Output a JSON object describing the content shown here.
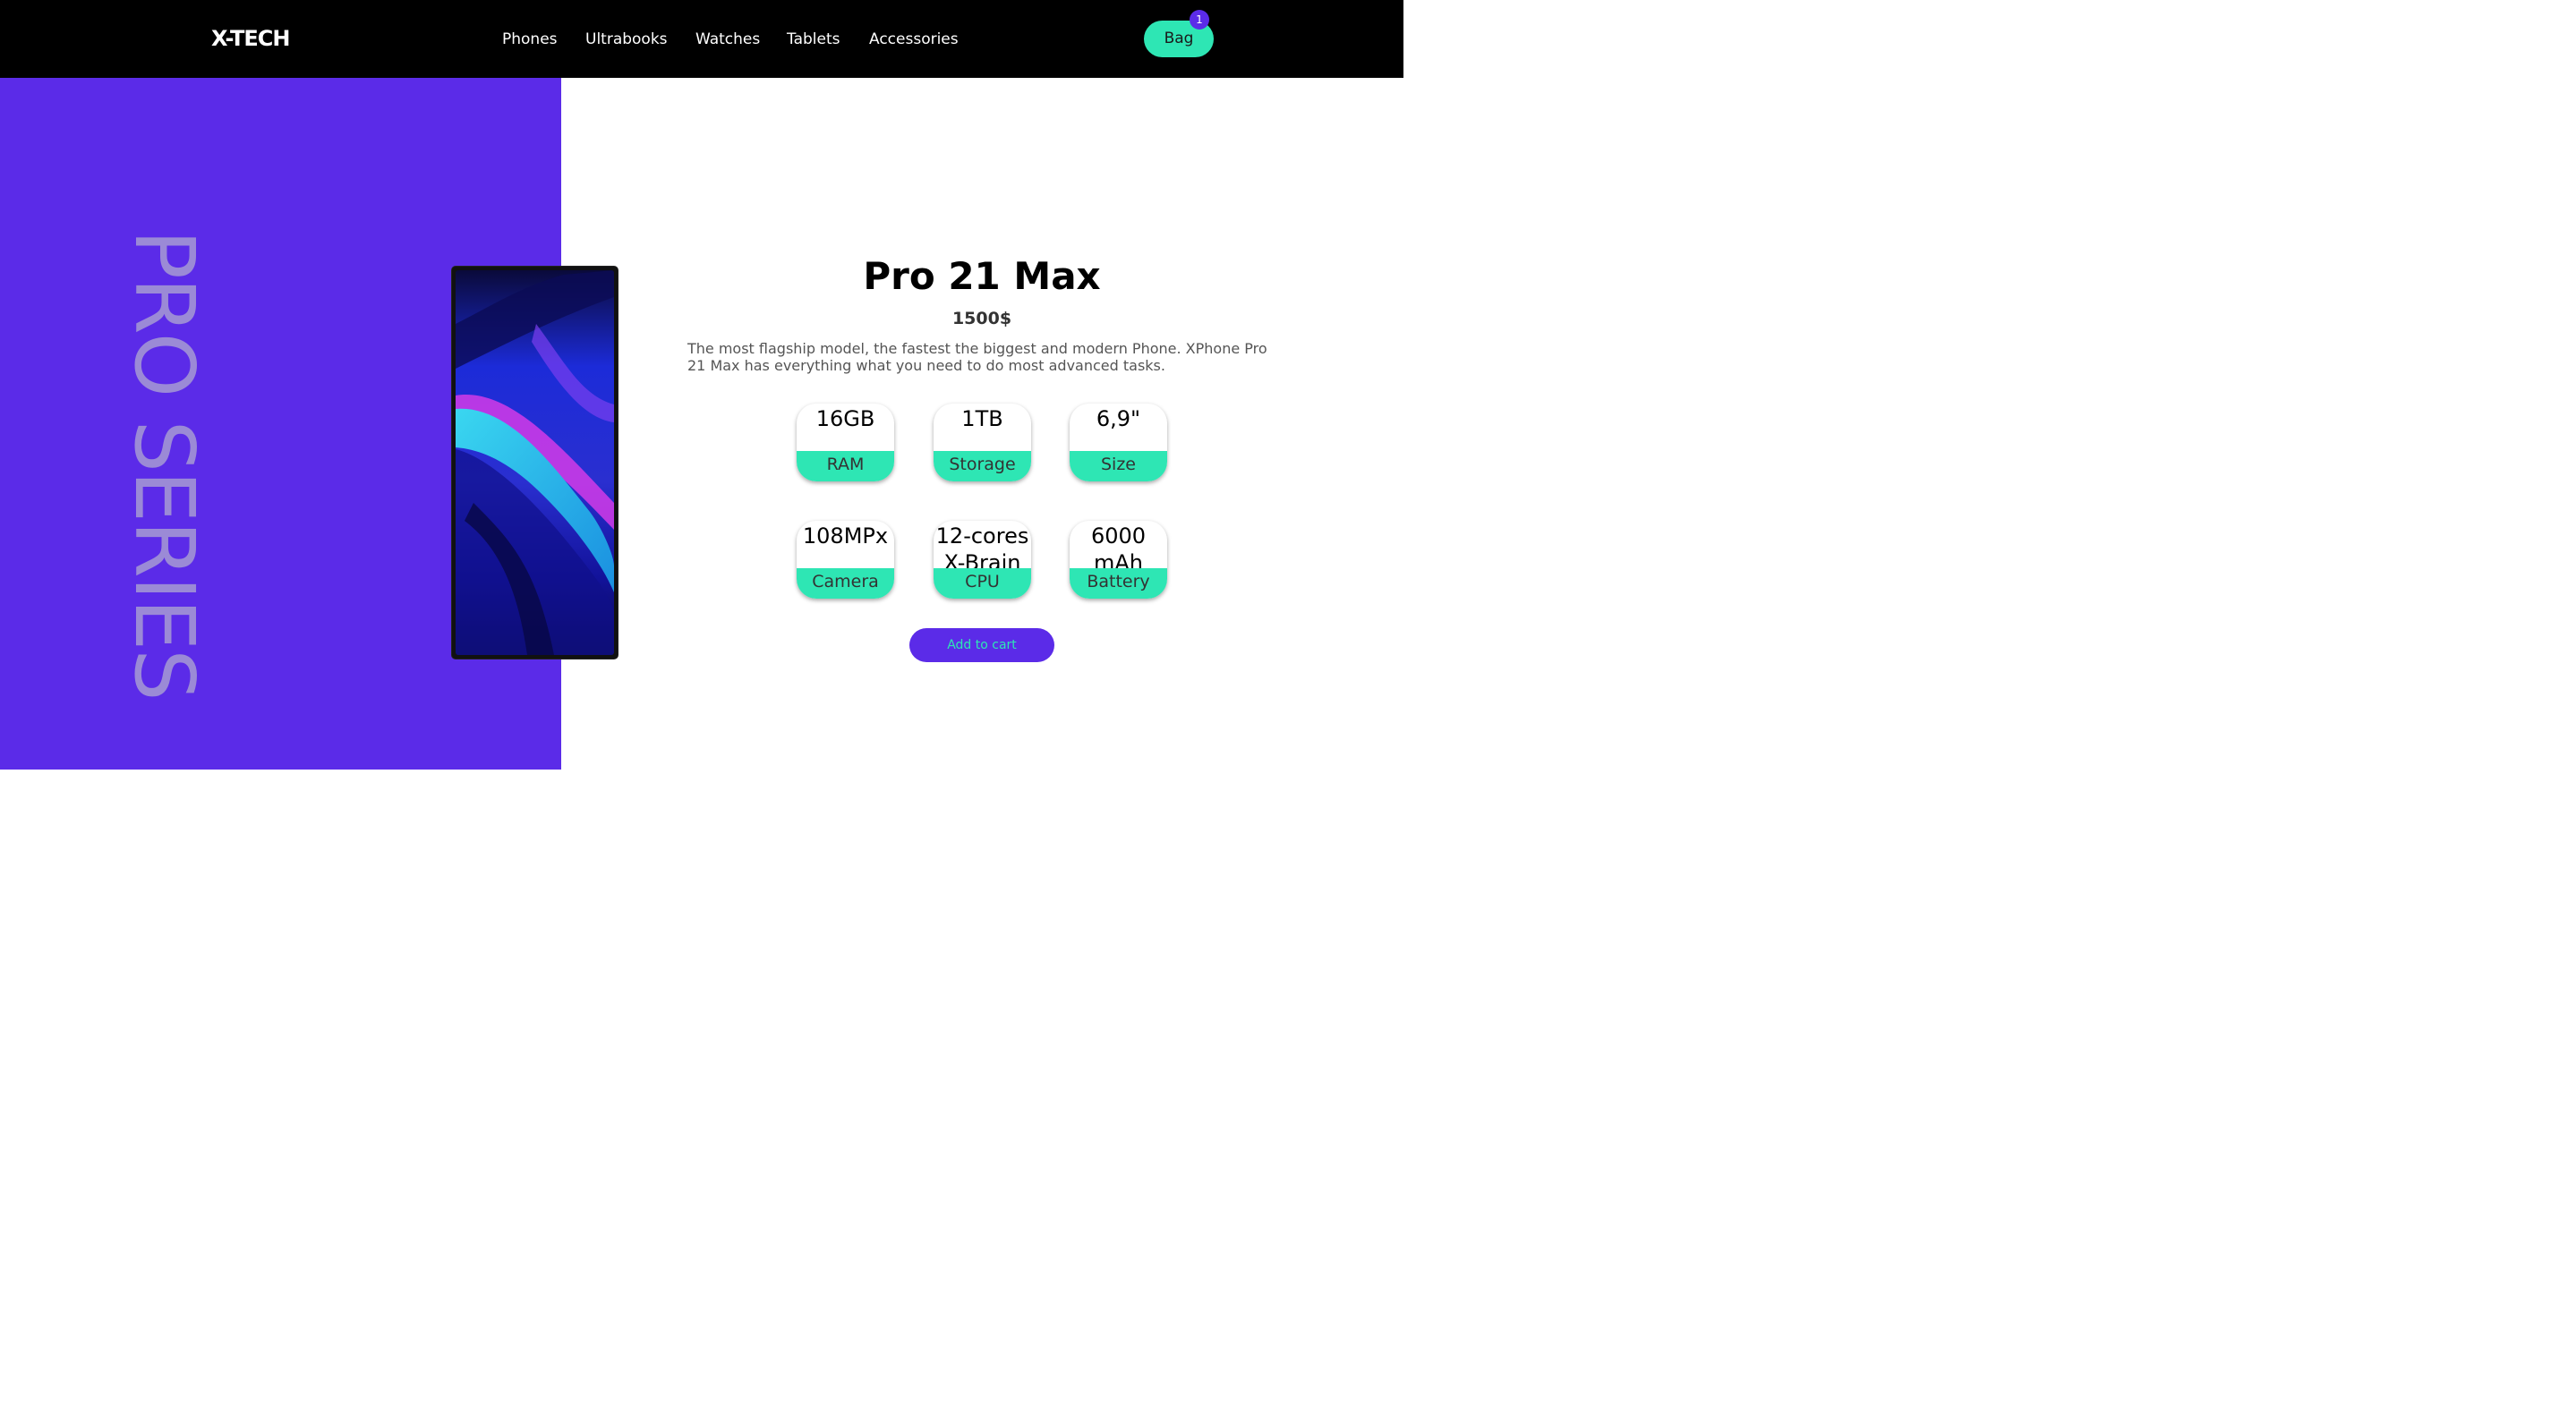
{
  "header": {
    "logo": "X-TECH",
    "nav": [
      "Phones",
      "Ultrabooks",
      "Watches",
      "Tablets",
      "Accessories"
    ],
    "bag_label": "Bag",
    "bag_count": "1"
  },
  "hero": {
    "series_text": "PRO SERIES"
  },
  "product": {
    "title": "Pro 21 Max",
    "price": "1500$",
    "description": "The most flagship model, the fastest the biggest and modern Phone. XPhone Pro 21 Max has everything what you need to do most advanced tasks.",
    "specs": [
      {
        "value": "16GB",
        "label": "RAM"
      },
      {
        "value": "1TB",
        "label": "Storage"
      },
      {
        "value": "6,9\"",
        "label": "Size"
      },
      {
        "value": "108MPx",
        "label": "Camera"
      },
      {
        "value": "12-cores X-Brain",
        "label": "CPU"
      },
      {
        "value": "6000 mAh",
        "label": "Battery"
      }
    ],
    "add_to_cart": "Add to cart"
  },
  "colors": {
    "accent_purple": "#5b2be8",
    "accent_mint": "#2ee6b4",
    "header_bg": "#000000"
  }
}
